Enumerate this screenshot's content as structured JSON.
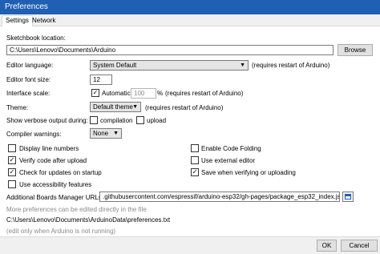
{
  "window": {
    "title": "Preferences"
  },
  "tabs": [
    {
      "label": "Settings",
      "active": true
    },
    {
      "label": "Network",
      "active": false
    }
  ],
  "sketchbook": {
    "label": "Sketchbook location:",
    "value": "C:\\Users\\Lenovo\\Documents\\Arduino",
    "browse_label": "Browse"
  },
  "editor_language": {
    "label": "Editor language:",
    "value": "System Default",
    "note": "(requires restart of Arduino)"
  },
  "font_size": {
    "label": "Editor font size:",
    "value": "12"
  },
  "interface_scale": {
    "label": "Interface scale:",
    "automatic_label": "Automatic",
    "automatic_checked": true,
    "value": "100",
    "unit": "%",
    "note": "(requires restart of Arduino)"
  },
  "theme": {
    "label": "Theme:",
    "value": "Default theme",
    "note": "(requires restart of Arduino)"
  },
  "verbose": {
    "label": "Show verbose output during:",
    "compilation_label": "compilation",
    "compilation_checked": false,
    "upload_label": "upload",
    "upload_checked": false
  },
  "compiler_warnings": {
    "label": "Compiler warnings:",
    "value": "None"
  },
  "options_left": [
    {
      "label": "Display line numbers",
      "checked": false
    },
    {
      "label": "Verify code after upload",
      "checked": true
    },
    {
      "label": "Check for updates on startup",
      "checked": true
    },
    {
      "label": "Use accessibility features",
      "checked": false
    }
  ],
  "options_right": [
    {
      "label": "Enable Code Folding",
      "checked": false
    },
    {
      "label": "Use external editor",
      "checked": false
    },
    {
      "label": "Save when verifying or uploading",
      "checked": true
    }
  ],
  "boards_manager": {
    "label": "Additional Boards Manager URLs:",
    "value": ".githubusercontent.com/espressif/arduino-esp32/gh-pages/package_esp32_index.json"
  },
  "more_prefs": {
    "text": "More preferences can be edited directly in the file",
    "path": "C:\\Users\\Lenovo\\Documents\\ArduinoData\\preferences.txt",
    "note": "(edit only when Arduino is not running)"
  },
  "buttons": {
    "ok": "OK",
    "cancel": "Cancel"
  },
  "colors": {
    "title_bar": "#1f5fb4",
    "panel": "#f0f0f0"
  }
}
